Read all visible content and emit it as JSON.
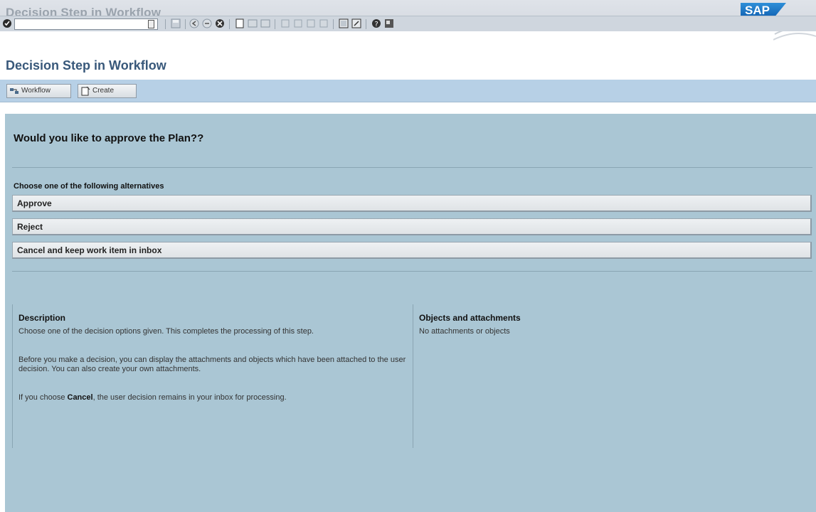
{
  "window": {
    "title": "Decision Step in Workflow",
    "logo": "SAP"
  },
  "toolbar": {
    "icons": [
      "check-icon",
      "back-icon",
      "save-icon",
      "nav-back-icon",
      "nav-exit-icon",
      "cancel-icon",
      "print-icon",
      "find-icon",
      "find-next-icon",
      "first-page-icon",
      "prev-page-icon",
      "next-page-icon",
      "last-page-icon",
      "new-session-icon",
      "shortcut-icon",
      "help-icon",
      "layout-icon"
    ],
    "command_value": ""
  },
  "screen": {
    "title": "Decision Step in Workflow"
  },
  "app_toolbar": {
    "workflow_label": "Workflow",
    "create_label": "Create"
  },
  "content": {
    "question": "Would you like to approve the Plan??",
    "choose_label": "Choose one of the following alternatives",
    "alternatives": [
      "Approve",
      "Reject",
      "Cancel and keep work item in inbox"
    ],
    "description": {
      "title": "Description",
      "p1": "Choose one of the decision options given. This completes the processing of this step.",
      "p2": "Before you make a decision, you can display the attachments and objects which have been attached to the user decision. You can also create your own attachments.",
      "p3_pre": "If you choose ",
      "p3_bold": "Cancel",
      "p3_post": ", the user decision remains in your inbox for processing."
    },
    "objects": {
      "title": "Objects and attachments",
      "text": "No attachments or objects"
    }
  },
  "colors": {
    "content_bg": "#aac6d4",
    "app_toolbar_bg": "#b7d0e6",
    "title_blue": "#38587a"
  }
}
